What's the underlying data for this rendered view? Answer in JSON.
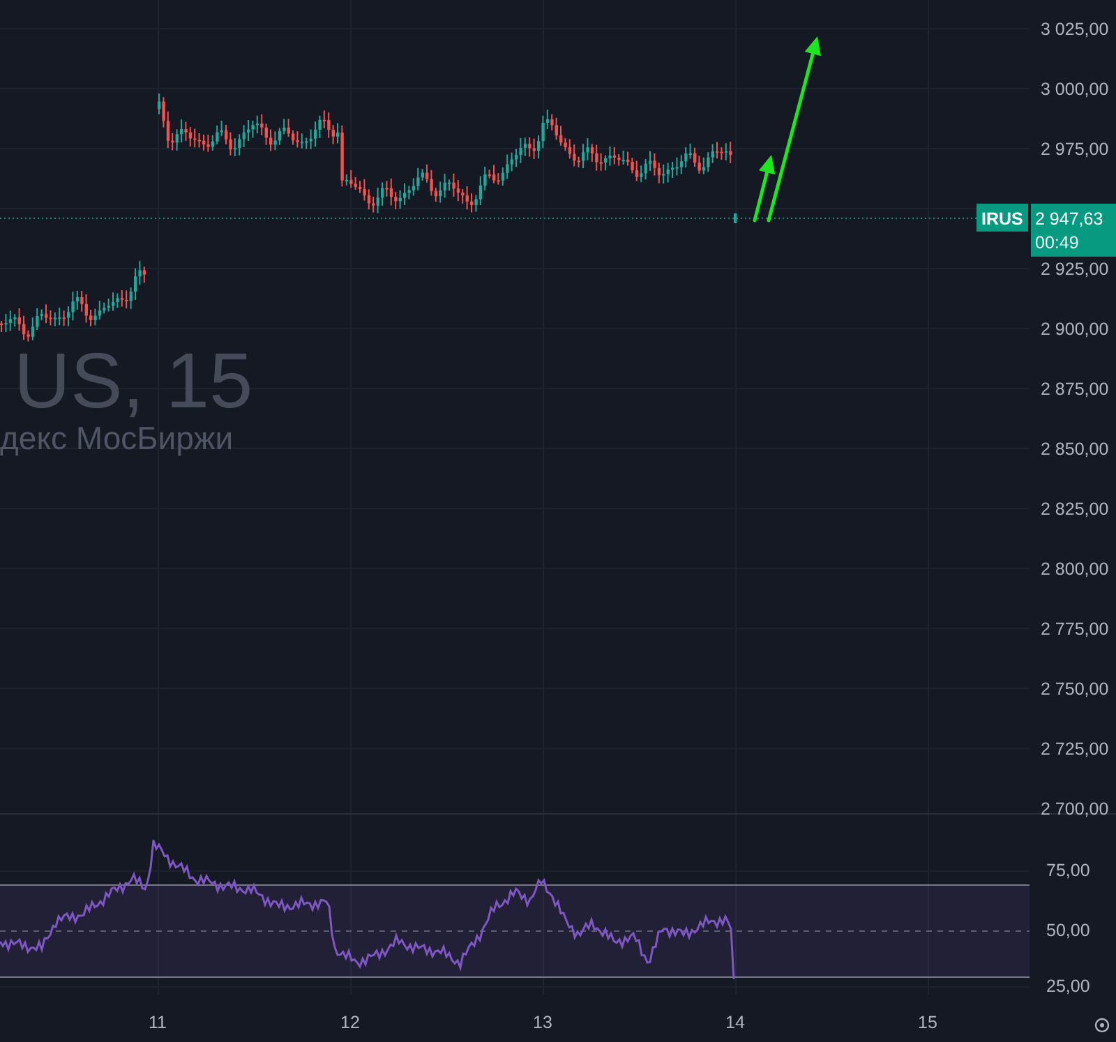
{
  "symbol_watermark": {
    "title": "US, 15",
    "subtitle": "декс МосБиржи"
  },
  "price_axis": {
    "labels": [
      "3 025,00",
      "3 000,00",
      "2 975,00",
      "2 925,00",
      "2 900,00",
      "2 875,00",
      "2 850,00",
      "2 825,00",
      "2 800,00",
      "2 775,00",
      "2 750,00",
      "2 725,00",
      "2 700,00"
    ]
  },
  "last_price": {
    "ticker": "IRUS",
    "price": "2 947,63",
    "countdown": "00:49"
  },
  "rsi_axis": {
    "labels": [
      "75,00",
      "50,00",
      "25,00"
    ]
  },
  "time_axis": {
    "labels": [
      "11",
      "12",
      "13",
      "14",
      "15"
    ]
  }
}
